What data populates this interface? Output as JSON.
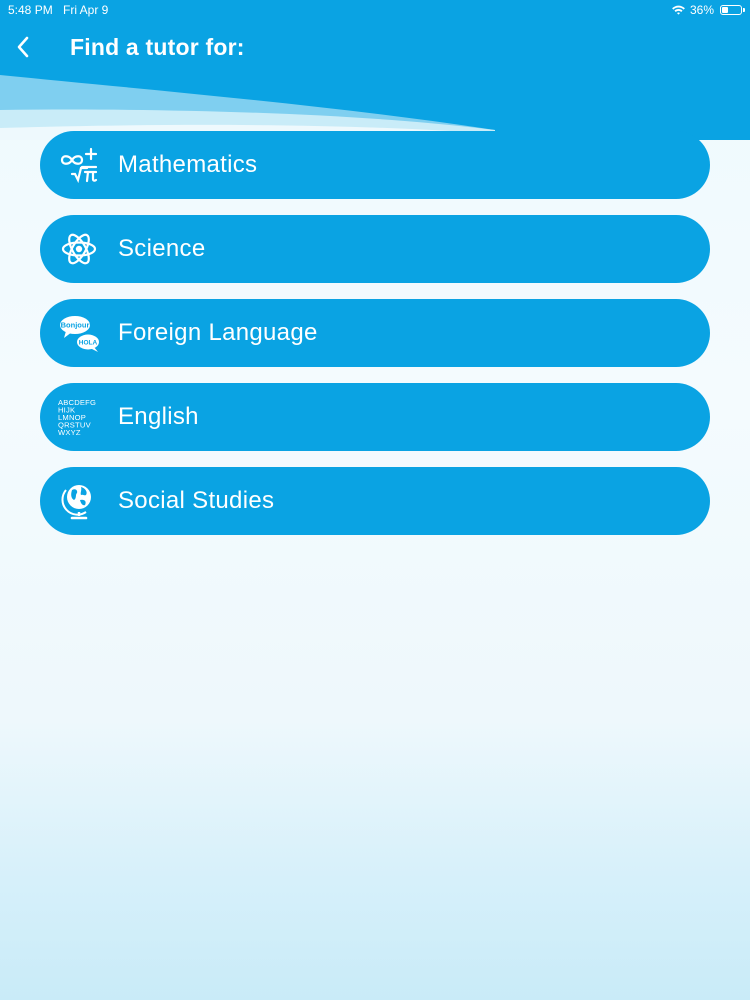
{
  "status_bar": {
    "time": "5:48 PM",
    "date": "Fri Apr 9",
    "battery_percent": "36%",
    "battery_level": 0.36,
    "wifi_icon": "wifi-icon"
  },
  "header": {
    "back_icon": "chevron-left-icon",
    "title": "Find a tutor for:"
  },
  "subjects": [
    {
      "label": "Mathematics",
      "icon": "math-symbols-icon"
    },
    {
      "label": "Science",
      "icon": "atom-icon"
    },
    {
      "label": "Foreign Language",
      "icon": "speech-bubbles-icon",
      "icon_text": [
        "Bonjour",
        "HOLA"
      ]
    },
    {
      "label": "English",
      "icon": "alphabet-icon",
      "icon_text": [
        "ABCDEFG",
        "HIJK",
        "LMNOP",
        "QRSTUV",
        "WXYZ"
      ]
    },
    {
      "label": "Social Studies",
      "icon": "globe-icon"
    }
  ],
  "colors": {
    "accent": "#0aa3e3",
    "text_on_accent": "#ffffff",
    "background": "#eef9fd"
  }
}
